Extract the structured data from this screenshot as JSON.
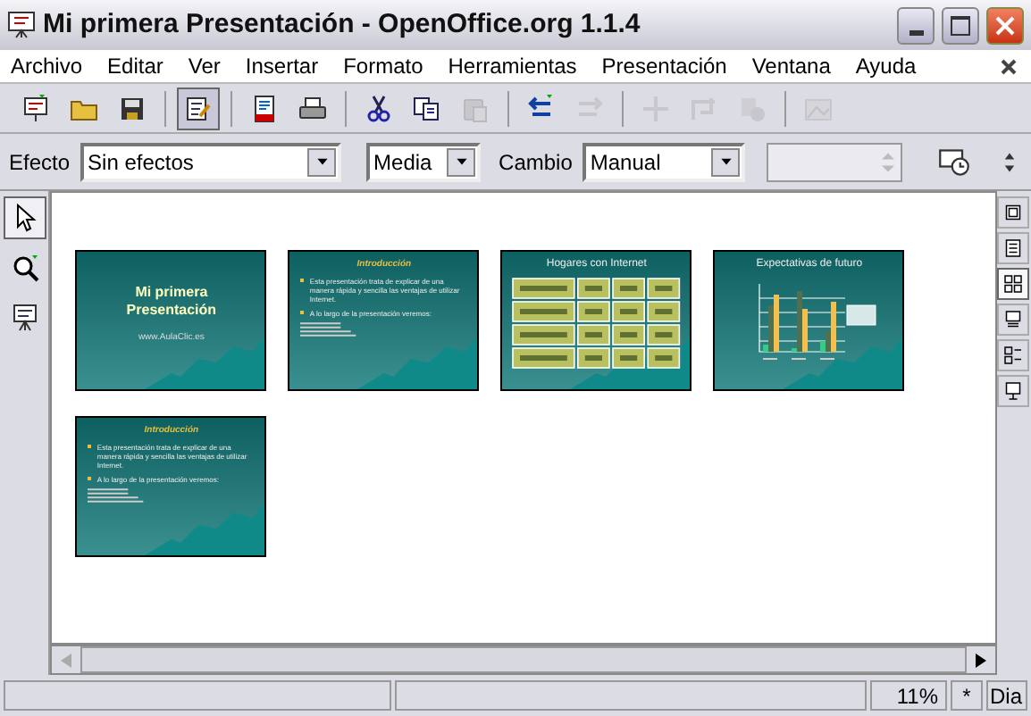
{
  "window": {
    "title": "Mi primera Presentación - OpenOffice.org 1.1.4"
  },
  "menu": [
    {
      "label": "Archivo"
    },
    {
      "label": "Editar"
    },
    {
      "label": "Ver"
    },
    {
      "label": "Insertar"
    },
    {
      "label": "Formato"
    },
    {
      "label": "Herramientas"
    },
    {
      "label": "Presentación"
    },
    {
      "label": "Ventana"
    },
    {
      "label": "Ayuda"
    }
  ],
  "toolbar": [
    {
      "disabled": false,
      "selected": false
    },
    {
      "disabled": false,
      "selected": false
    },
    {
      "disabled": false,
      "selected": false
    },
    {
      "disabled": false,
      "selected": true
    },
    {
      "disabled": false,
      "selected": false
    },
    {
      "disabled": false,
      "selected": false
    },
    {
      "disabled": false,
      "selected": false
    },
    {
      "disabled": false,
      "selected": false
    },
    {
      "disabled": true,
      "selected": false
    },
    {
      "disabled": false,
      "selected": false
    },
    {
      "disabled": true,
      "selected": false
    },
    {
      "disabled": true,
      "selected": false
    },
    {
      "disabled": true,
      "selected": false
    },
    {
      "disabled": true,
      "selected": false
    },
    {
      "disabled": true,
      "selected": false
    }
  ],
  "object_bar": {
    "effect_label": "Efecto",
    "effect": "Sin efectos",
    "speed": "Media",
    "change_label": "Cambio",
    "change": "Manual"
  },
  "left_tools": [
    {
      "selected": true
    },
    {
      "selected": false
    },
    {
      "selected": false
    }
  ],
  "right_tools": [
    {
      "selected": false
    },
    {
      "selected": false
    },
    {
      "selected": true
    },
    {
      "selected": false
    },
    {
      "selected": false
    },
    {
      "selected": false
    }
  ],
  "slides": [
    {
      "kind": "title",
      "title": "Mi primera Presentación",
      "subtitle": "www.AulaClic.es"
    },
    {
      "kind": "bullets",
      "title": "Introducción",
      "bullets": [
        "Esta presentación trata de explicar de una manera rápida y sencilla las ventajas de utilizar Internet.",
        "A lo largo de la presentación veremos:"
      ]
    },
    {
      "kind": "table",
      "title": "Hogares con Internet"
    },
    {
      "kind": "chart",
      "title": "Expectativas de futuro"
    },
    {
      "kind": "bullets",
      "title": "Introducción",
      "bullets": [
        "Esta presentación trata de explicar de una manera rápida y sencilla las ventajas de utilizar Internet.",
        "A lo largo de la presentación veremos:"
      ]
    }
  ],
  "status_bar": {
    "zoom": "11%",
    "modified": "*",
    "layout": "Dia"
  }
}
